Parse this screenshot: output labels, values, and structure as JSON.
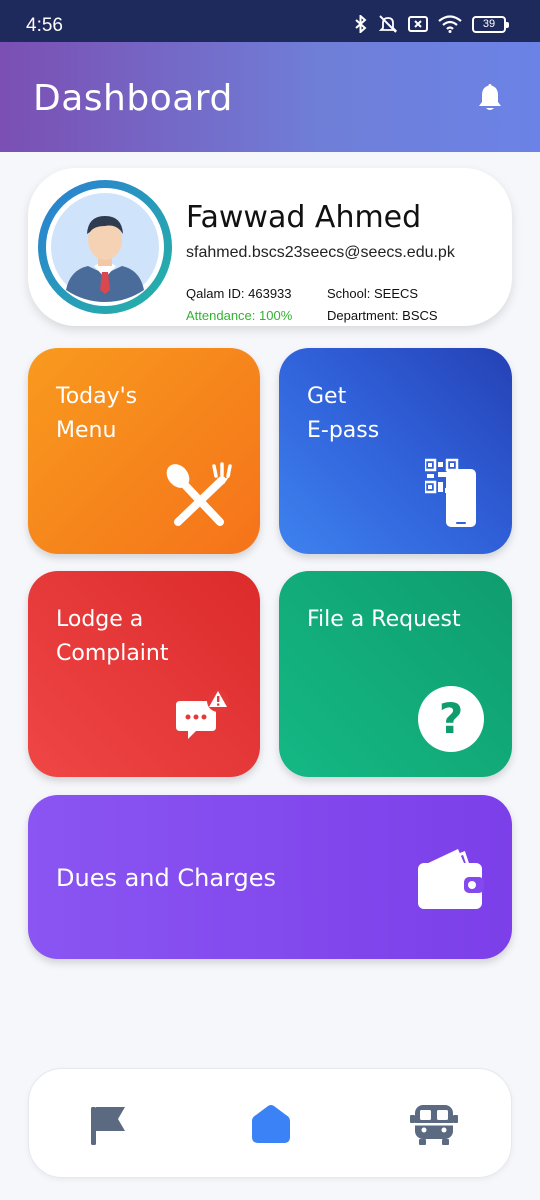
{
  "status_bar": {
    "time": "4:56",
    "battery": "39",
    "icons": [
      "bluetooth-icon",
      "mute-icon",
      "sim-off-icon",
      "wifi-icon",
      "battery-icon"
    ]
  },
  "app_bar": {
    "title": "Dashboard",
    "icon": "bell-icon"
  },
  "profile": {
    "name": "Fawwad Ahmed",
    "email": "sfahmed.bscs23seecs@seecs.edu.pk",
    "qalam_id": "Qalam ID: 463933",
    "school": "School: SEECS",
    "attendance": "Attendance: 100%",
    "department": "Department: BSCS",
    "accent_color": "#2fb42f"
  },
  "tiles": {
    "menu": {
      "label": "Today's\nMenu",
      "icon": "utensils-icon",
      "color": "#f5831a"
    },
    "epass": {
      "label": "Get\nE-pass",
      "icon": "qr-phone-icon",
      "color": "#3062da"
    },
    "complaint": {
      "label": "Lodge a\nComplaint",
      "icon": "complaint-chat-icon",
      "color": "#e53838"
    },
    "request": {
      "label": "File a Request",
      "icon": "question-icon",
      "color": "#12aa78"
    },
    "dues": {
      "label": "Dues and Charges",
      "icon": "wallet-icon",
      "color": "#8349ee"
    }
  },
  "bottom_nav": {
    "items": [
      {
        "icon": "flag-icon",
        "active": false
      },
      {
        "icon": "home-icon",
        "active": true
      },
      {
        "icon": "bus-icon",
        "active": false
      }
    ],
    "active_color": "#3b82f6",
    "inactive_color": "#5b6a80"
  }
}
